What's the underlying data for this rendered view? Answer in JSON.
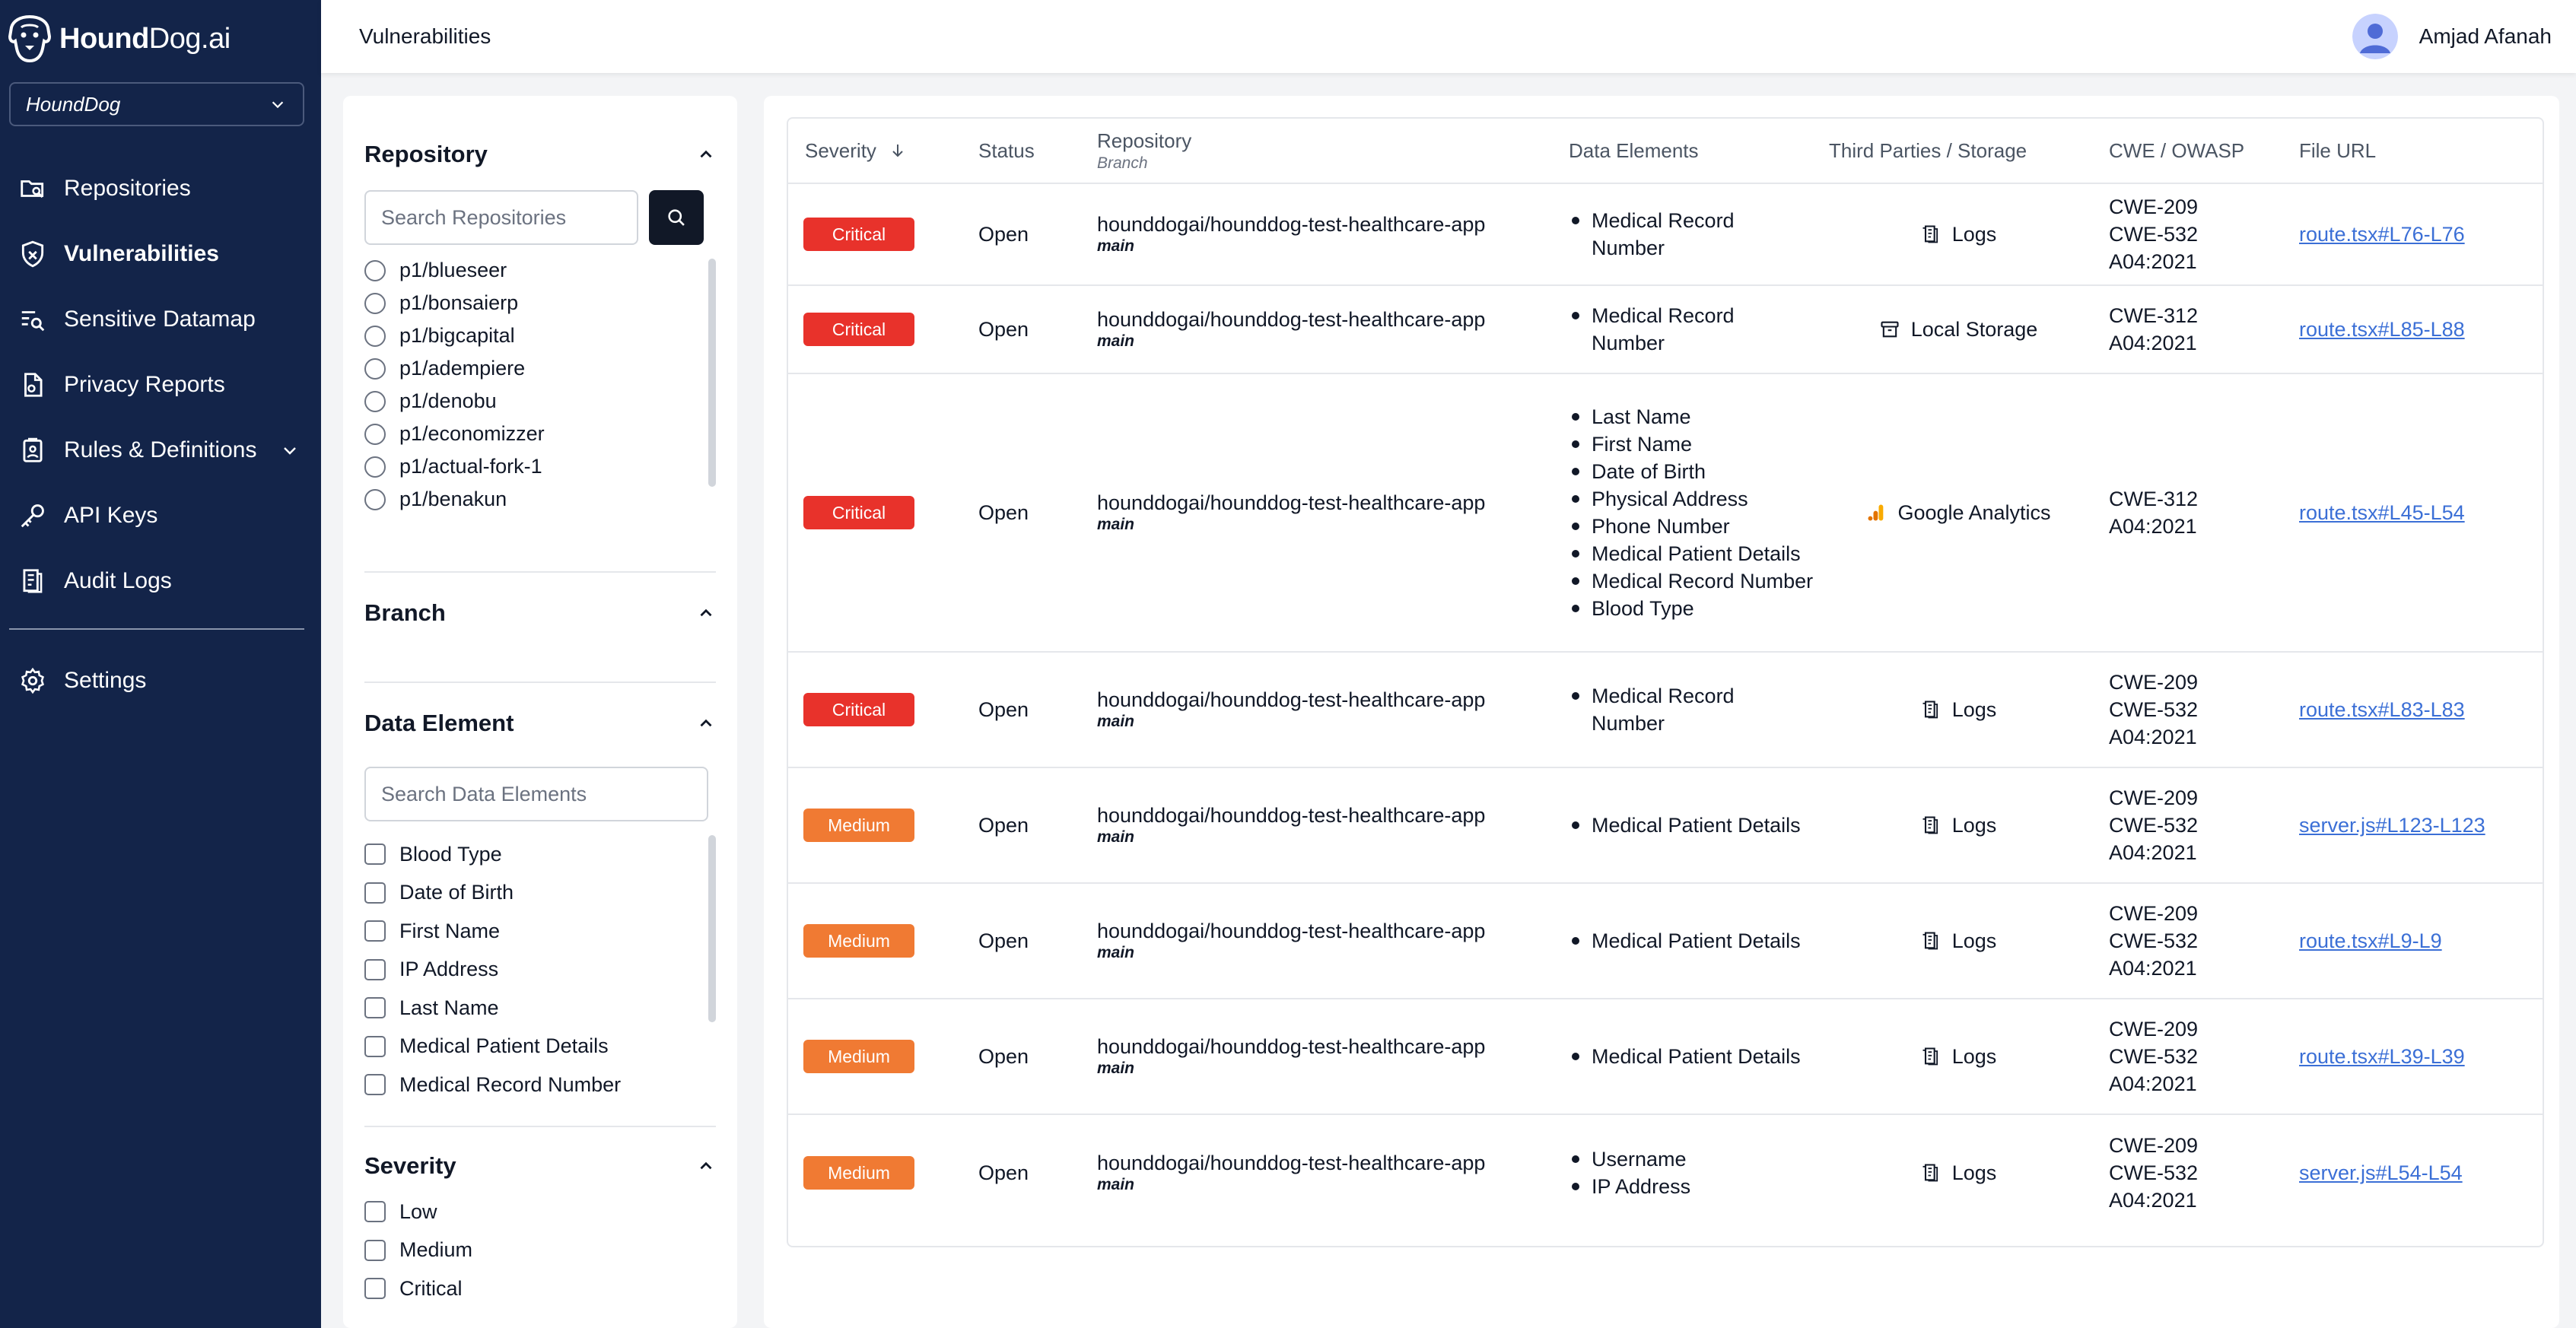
{
  "brand": {
    "name_bold": "Hound",
    "name_rest": "Dog.ai"
  },
  "org_select": {
    "value": "HoundDog"
  },
  "nav": {
    "items": [
      {
        "label": "Repositories"
      },
      {
        "label": "Vulnerabilities"
      },
      {
        "label": "Sensitive Datamap"
      },
      {
        "label": "Privacy Reports"
      },
      {
        "label": "Rules & Definitions"
      },
      {
        "label": "API Keys"
      },
      {
        "label": "Audit Logs"
      }
    ],
    "settings_label": "Settings"
  },
  "header": {
    "title": "Vulnerabilities",
    "user_name": "Amjad Afanah"
  },
  "filters": {
    "repository": {
      "title": "Repository",
      "search_placeholder": "Search Repositories",
      "options": [
        "p1/blueseer",
        "p1/bonsaierp",
        "p1/bigcapital",
        "p1/adempiere",
        "p1/denobu",
        "p1/economizzer",
        "p1/actual-fork-1",
        "p1/benakun"
      ]
    },
    "branch": {
      "title": "Branch"
    },
    "data_element": {
      "title": "Data Element",
      "search_placeholder": "Search Data Elements",
      "options": [
        "Blood Type",
        "Date of Birth",
        "First Name",
        "IP Address",
        "Last Name",
        "Medical Patient Details",
        "Medical Record Number"
      ]
    },
    "severity": {
      "title": "Severity",
      "options": [
        "Low",
        "Medium",
        "Critical"
      ]
    }
  },
  "table": {
    "headers": {
      "severity": "Severity",
      "status": "Status",
      "repository": "Repository",
      "repository_sub": "Branch",
      "data_elements": "Data Elements",
      "third_parties": "Third Parties / Storage",
      "cwe": "CWE / OWASP",
      "file_url": "File URL"
    },
    "colors": {
      "critical": "#e8322b",
      "medium": "#f07a33"
    },
    "rows": [
      {
        "severity": "Critical",
        "status": "Open",
        "repo": "hounddogai/hounddog-test-healthcare-app",
        "branch": "main",
        "data_elements": [
          "Medical Record Number"
        ],
        "third_party": "Logs",
        "tp_icon": "logs-icon",
        "cwe": [
          "CWE-209",
          "CWE-532",
          "A04:2021"
        ],
        "file": "route.tsx#L76-L76"
      },
      {
        "severity": "Critical",
        "status": "Open",
        "repo": "hounddogai/hounddog-test-healthcare-app",
        "branch": "main",
        "data_elements": [
          "Medical Record Number"
        ],
        "third_party": "Local Storage",
        "tp_icon": "archive-icon",
        "cwe": [
          "CWE-312",
          "A04:2021"
        ],
        "file": "route.tsx#L85-L88"
      },
      {
        "severity": "Critical",
        "status": "Open",
        "repo": "hounddogai/hounddog-test-healthcare-app",
        "branch": "main",
        "data_elements": [
          "Last Name",
          "First Name",
          "Date of Birth",
          "Physical Address",
          "Phone Number",
          "Medical Patient Details",
          "Medical Record Number",
          "Blood Type"
        ],
        "third_party": "Google Analytics",
        "tp_icon": "google-analytics-icon",
        "cwe": [
          "CWE-312",
          "A04:2021"
        ],
        "file": "route.tsx#L45-L54"
      },
      {
        "severity": "Critical",
        "status": "Open",
        "repo": "hounddogai/hounddog-test-healthcare-app",
        "branch": "main",
        "data_elements": [
          "Medical Record Number"
        ],
        "third_party": "Logs",
        "tp_icon": "logs-icon",
        "cwe": [
          "CWE-209",
          "CWE-532",
          "A04:2021"
        ],
        "file": "route.tsx#L83-L83"
      },
      {
        "severity": "Medium",
        "status": "Open",
        "repo": "hounddogai/hounddog-test-healthcare-app",
        "branch": "main",
        "data_elements": [
          "Medical Patient Details"
        ],
        "third_party": "Logs",
        "tp_icon": "logs-icon",
        "cwe": [
          "CWE-209",
          "CWE-532",
          "A04:2021"
        ],
        "file": "server.js#L123-L123"
      },
      {
        "severity": "Medium",
        "status": "Open",
        "repo": "hounddogai/hounddog-test-healthcare-app",
        "branch": "main",
        "data_elements": [
          "Medical Patient Details"
        ],
        "third_party": "Logs",
        "tp_icon": "logs-icon",
        "cwe": [
          "CWE-209",
          "CWE-532",
          "A04:2021"
        ],
        "file": "route.tsx#L9-L9"
      },
      {
        "severity": "Medium",
        "status": "Open",
        "repo": "hounddogai/hounddog-test-healthcare-app",
        "branch": "main",
        "data_elements": [
          "Medical Patient Details"
        ],
        "third_party": "Logs",
        "tp_icon": "logs-icon",
        "cwe": [
          "CWE-209",
          "CWE-532",
          "A04:2021"
        ],
        "file": "route.tsx#L39-L39"
      },
      {
        "severity": "Medium",
        "status": "Open",
        "repo": "hounddogai/hounddog-test-healthcare-app",
        "branch": "main",
        "data_elements": [
          "Username",
          "IP Address"
        ],
        "third_party": "Logs",
        "tp_icon": "logs-icon",
        "cwe": [
          "CWE-209",
          "CWE-532",
          "A04:2021"
        ],
        "file": "server.js#L54-L54"
      }
    ]
  }
}
